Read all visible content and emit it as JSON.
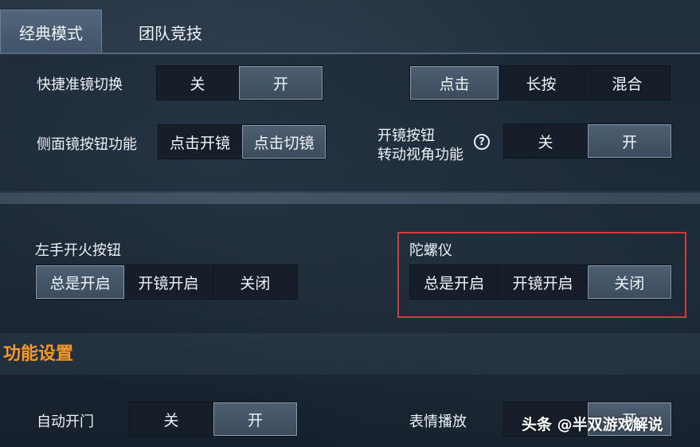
{
  "tabs": {
    "classic": "经典模式",
    "team": "团队竞技"
  },
  "rows": {
    "quick_scope": {
      "label": "快捷准镜切换",
      "off": "关",
      "on": "开"
    },
    "aim_mode": {
      "tap": "点击",
      "hold": "长按",
      "mixed": "混合"
    },
    "side_scope": {
      "label": "侧面镜按钮功能",
      "tap_open": "点击开镜",
      "tap_switch": "点击切镜"
    },
    "scope_rotate": {
      "label_line1": "开镜按钮",
      "label_line2": "转动视角功能",
      "help": "?",
      "off": "关",
      "on": "开"
    },
    "left_fire": {
      "label": "左手开火按钮",
      "always": "总是开启",
      "scope_on": "开镜开启",
      "close": "关闭"
    },
    "gyro": {
      "label": "陀螺仪",
      "always": "总是开启",
      "scope_on": "开镜开启",
      "close": "关闭"
    },
    "auto_door": {
      "label": "自动开门",
      "off": "关",
      "on": "开"
    },
    "emote": {
      "label": "表情播放",
      "on": "开"
    }
  },
  "section": {
    "title": "功能设置"
  },
  "watermark": "头条 @半双游戏解说",
  "colors": {
    "accent": "#f59a2a",
    "highlight": "#d33a3a"
  }
}
